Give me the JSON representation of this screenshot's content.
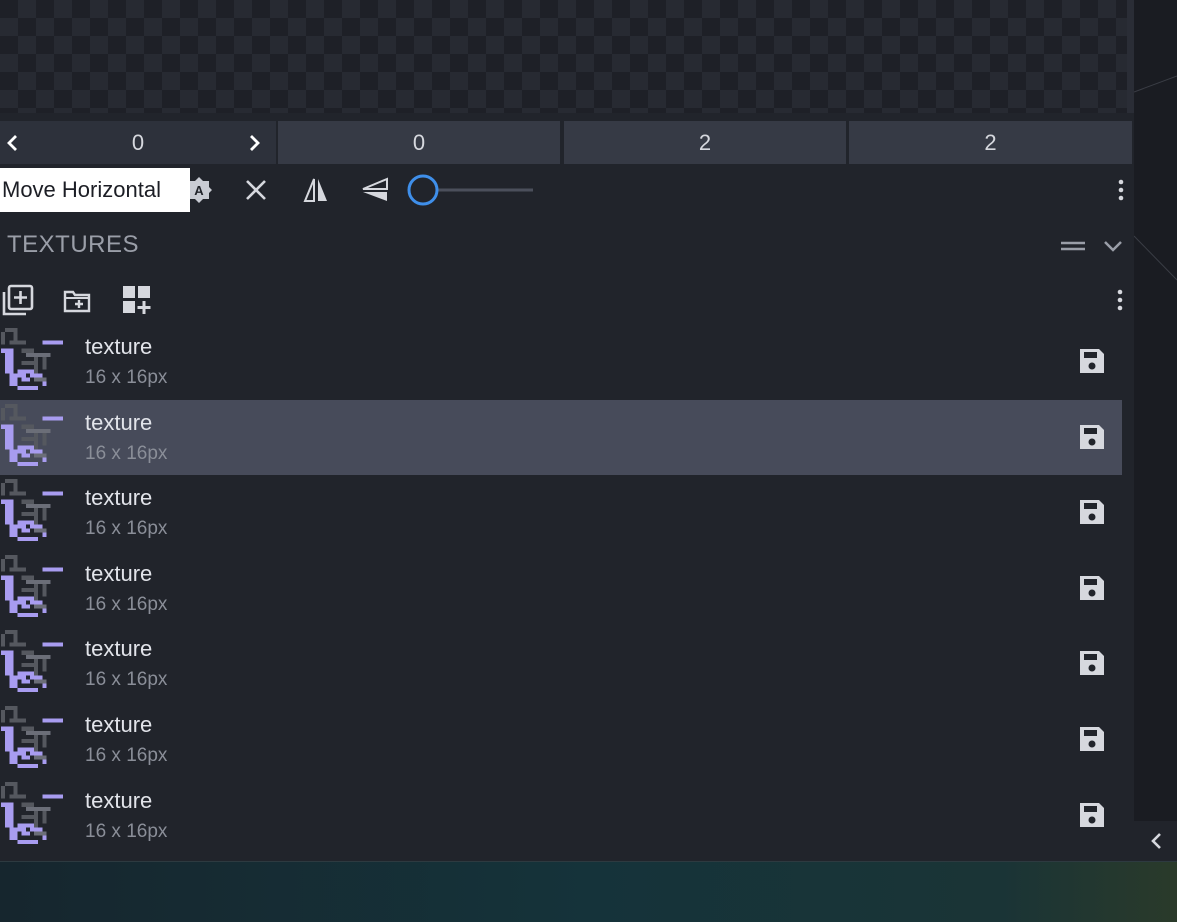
{
  "uv": {
    "fields": [
      "0",
      "0",
      "2",
      "2"
    ],
    "prev_icon": "chevron-left-icon",
    "next_icon": "chevron-right-icon"
  },
  "tooltip": {
    "text": "Move Horizontal"
  },
  "toolbar": {
    "icons": [
      "auto-uv-icon",
      "close-icon",
      "mirror-horizontal-icon",
      "mirror-vertical-icon",
      "slider",
      "more-vertical-icon"
    ],
    "slider_value": 0
  },
  "textures_panel": {
    "title": "TEXTURES",
    "header_icons": [
      "fold-icon",
      "chevron-down-icon"
    ],
    "toolbar_icons": [
      "add-texture-icon",
      "import-texture-icon",
      "create-texture-icon",
      "more-vertical-icon"
    ],
    "items": [
      {
        "name": "texture",
        "size": "16 x 16px",
        "selected": false
      },
      {
        "name": "texture",
        "size": "16 x 16px",
        "selected": true
      },
      {
        "name": "texture",
        "size": "16 x 16px",
        "selected": false
      },
      {
        "name": "texture",
        "size": "16 x 16px",
        "selected": false
      },
      {
        "name": "texture",
        "size": "16 x 16px",
        "selected": false
      },
      {
        "name": "texture",
        "size": "16 x 16px",
        "selected": false
      },
      {
        "name": "texture",
        "size": "16 x 16px",
        "selected": false
      }
    ]
  },
  "sidebar": {
    "collapse_icon": "chevron-left-icon"
  },
  "colors": {
    "panel_bg": "#21242b",
    "selected_row": "#474b5a",
    "accent": "#3f8fea",
    "texture_purple": "#a89cf0"
  }
}
